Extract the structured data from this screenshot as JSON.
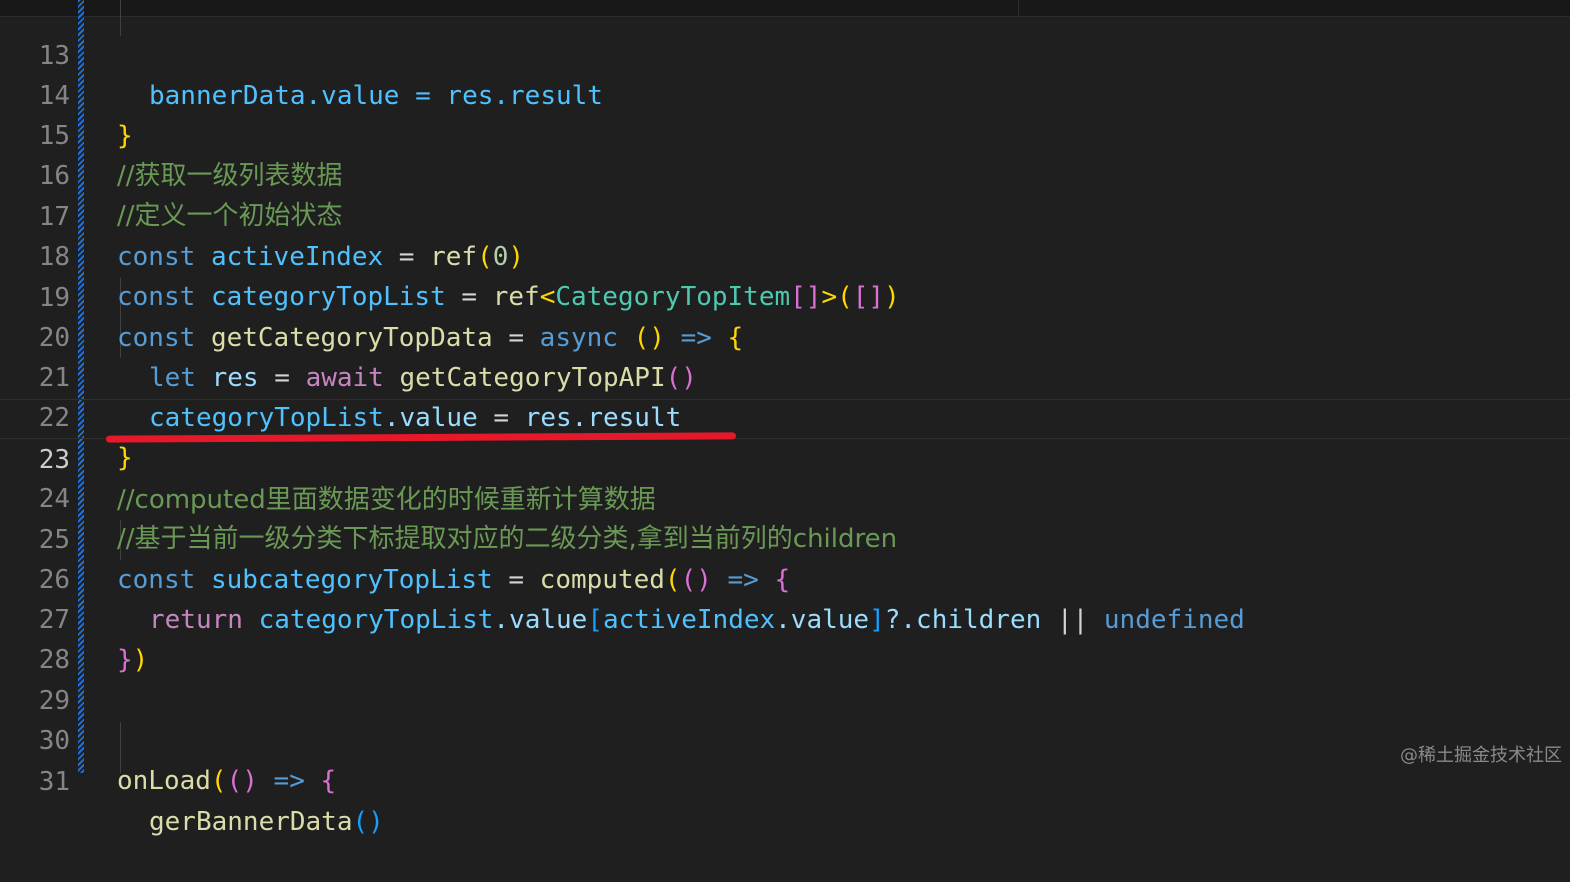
{
  "line_numbers": [
    "13",
    "14",
    "15",
    "16",
    "17",
    "18",
    "19",
    "20",
    "21",
    "22",
    "23",
    "24",
    "25",
    "26",
    "27",
    "28",
    "29",
    "30",
    "31"
  ],
  "active_line": "23",
  "code": {
    "l13": [
      "bannerData.value = res.result"
    ],
    "l14": [
      "}"
    ],
    "l15": "//获取一级列表数据",
    "l16": "//定义一个初始状态",
    "l17": [
      "const",
      "activeIndex",
      "=",
      "ref",
      "(",
      "0",
      ")"
    ],
    "l18": [
      "const",
      "categoryTopList",
      "=",
      "ref",
      "<",
      "CategoryTopItem",
      "[]",
      ">",
      "(",
      "[]",
      ")"
    ],
    "l19": [
      "const",
      "getCategoryTopData",
      "=",
      "async",
      "()",
      "=>",
      "{"
    ],
    "l20": [
      "let",
      "res",
      "=",
      "await",
      "getCategoryTopAPI",
      "()"
    ],
    "l21": [
      "categoryTopList",
      ".value",
      "=",
      "res",
      ".result"
    ],
    "l22": [
      "}"
    ],
    "l23": "//computed里面数据变化的时候重新计算数据",
    "l24": "//基于当前一级分类下标提取对应的二级分类,拿到当前列的children",
    "l25": [
      "const",
      "subcategoryTopList",
      "=",
      "computed",
      "(",
      "()",
      "=>",
      "{"
    ],
    "l26": [
      "return",
      "categoryTopList",
      ".value",
      "[",
      "activeIndex",
      ".value",
      "]",
      "?.children",
      "||",
      "undefined"
    ],
    "l27": [
      "}",
      ")"
    ],
    "l30": [
      "onLoad",
      "(",
      "()",
      "=>",
      "{"
    ],
    "l31": [
      "gerBannerData",
      "()"
    ]
  },
  "watermark": "@稀土掘金技术社区",
  "colors": {
    "background": "#1f1f1f",
    "keyword": "#569cd6",
    "control": "#c586c0",
    "variable": "#4fc1ff",
    "function": "#dcdcaa",
    "type": "#4ec9b0",
    "comment": "#6a9955",
    "annotation_underline": "#e8182b"
  }
}
